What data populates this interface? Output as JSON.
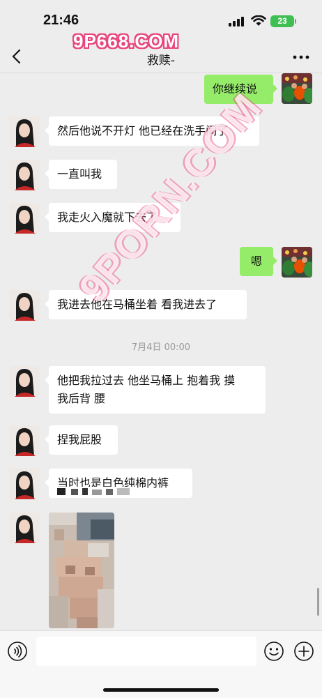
{
  "status_bar": {
    "time": "21:46",
    "battery": "23"
  },
  "watermark": {
    "top": "9P668.COM",
    "diagonal": "9PORN.COM"
  },
  "nav": {
    "title": "救赎-"
  },
  "messages": {
    "m1": "你继续说",
    "m2": "然后他说不开灯 他已经在洗手间了",
    "m3": "一直叫我",
    "m4": "我走火入魔就下去了",
    "m5": "嗯",
    "m6": "我进去他在马桶坐着 看我进去了",
    "m8_line1": "他把我拉过去 他坐马桶上 抱着我 摸",
    "m8_line2": "我后背 腰",
    "m9": "捏我屁股",
    "m10": "当时也是白色纯棉内裤"
  },
  "timestamp": "7月4日 00:00",
  "icons": {
    "back": "chevron-left-icon",
    "more": "more-dots-icon",
    "voice": "voice-icon",
    "emoji": "emoji-icon",
    "plus": "plus-icon"
  },
  "colors": {
    "sent_bubble": "#95ec69",
    "received_bubble": "#ffffff",
    "background": "#ededed",
    "watermark": "#e8457c"
  }
}
